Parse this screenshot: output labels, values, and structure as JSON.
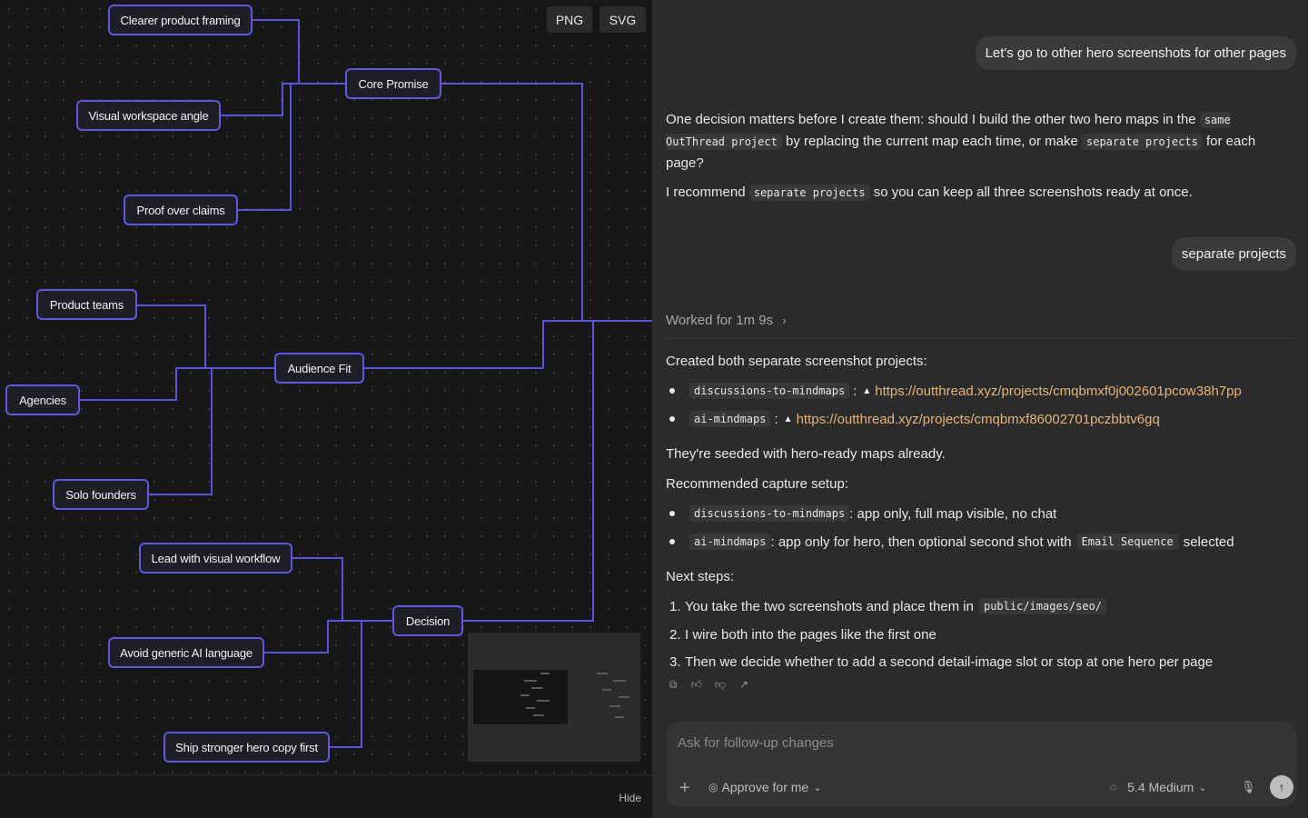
{
  "mindmap": {
    "export": {
      "png_label": "PNG",
      "svg_label": "SVG"
    },
    "hide_label": "Hide",
    "nodes": {
      "core": "Core Promise",
      "clearer": "Clearer product framing",
      "visual": "Visual workspace angle",
      "proof": "Proof over claims",
      "audience": "Audience Fit",
      "product_teams": "Product teams",
      "agencies": "Agencies",
      "solo": "Solo founders",
      "decision": "Decision",
      "lead": "Lead with visual workflow",
      "avoid": "Avoid generic AI language",
      "ship": "Ship stronger hero copy first"
    },
    "colors": {
      "edge": "#5b54d8",
      "node_border": "#5f57dd"
    }
  },
  "chat": {
    "msg1": "Let's go to other hero screenshots for other pages",
    "reply1": {
      "p1_a": "One decision matters before I create them: should I build the other two hero maps in the",
      "p1_code1": "same OutThread project",
      "p1_b": "by replacing the current map each time, or make",
      "p1_code2": "separate projects",
      "p1_c": "for each page?",
      "p2_a": "I recommend",
      "p2_code": "separate projects",
      "p2_b": "so you can keep all three screenshots ready at once."
    },
    "msg2": "separate projects",
    "worked": "Worked for 1m 9s",
    "reply2": {
      "intro": "Created both separate screenshot projects:",
      "projects": [
        {
          "name": "discussions-to-mindmaps",
          "sep": ":",
          "url": "https://outthread.xyz/projects/cmqbmxf0j002601pcow38h7pp"
        },
        {
          "name": "ai-mindmaps",
          "sep": ":",
          "url": "https://outthread.xyz/projects/cmqbmxf86002701pczbbtv6gq"
        }
      ],
      "seeded": "They're seeded with hero-ready maps already.",
      "setup_title": "Recommended capture setup:",
      "setup": [
        {
          "code": "discussions-to-mindmaps",
          "text": ": app only, full map visible, no chat"
        },
        {
          "code": "ai-mindmaps",
          "text": ": app only for hero, then optional second shot with",
          "code2": "Email Sequence",
          "text2": "selected"
        }
      ],
      "next_title": "Next steps:",
      "steps": [
        {
          "num": "1.",
          "text": "You take the two screenshots and place them in",
          "code": "public/images/seo/"
        },
        {
          "num": "2.",
          "text": "I wire both into the pages like the first one"
        },
        {
          "num": "3.",
          "text": "Then we decide whether to add a second detail-image slot or stop at one hero per page"
        }
      ]
    },
    "composer": {
      "placeholder": "Ask for follow-up changes",
      "approve_label": "Approve for me",
      "model_label": "5.4 Medium"
    },
    "colors": {
      "link": "#e5b47a",
      "panel": "#2b2b2b"
    }
  }
}
